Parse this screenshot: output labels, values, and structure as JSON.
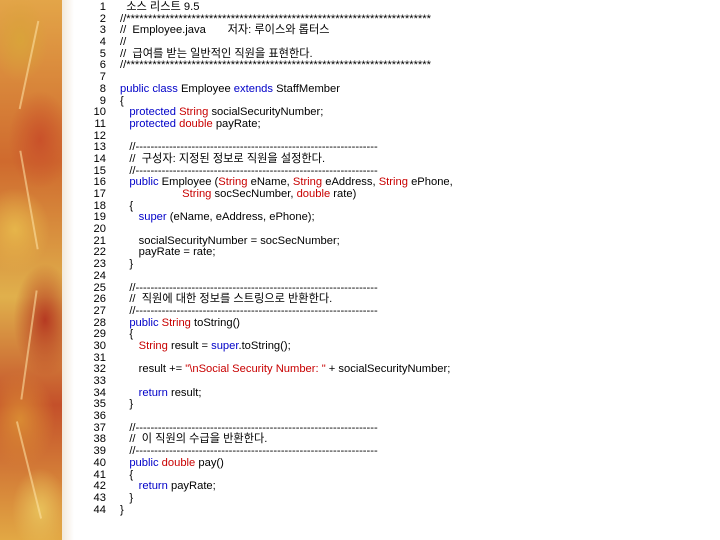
{
  "lines": [
    {
      "n": "1",
      "segs": [
        {
          "c": "cm",
          "t": "  소스 리스트 9.5"
        }
      ]
    },
    {
      "n": "2",
      "segs": [
        {
          "c": "cm",
          "t": "//**********************************************************************"
        }
      ]
    },
    {
      "n": "3",
      "segs": [
        {
          "c": "cm",
          "t": "//  Employee.java       저자: 루이스와 롭터스"
        }
      ]
    },
    {
      "n": "4",
      "segs": [
        {
          "c": "cm",
          "t": "//"
        }
      ]
    },
    {
      "n": "5",
      "segs": [
        {
          "c": "cm",
          "t": "//  급여를 받는 일반적인 직원을 표현한다."
        }
      ]
    },
    {
      "n": "6",
      "segs": [
        {
          "c": "cm",
          "t": "//**********************************************************************"
        }
      ]
    },
    {
      "n": "7",
      "segs": []
    },
    {
      "n": "8",
      "segs": [
        {
          "c": "kw",
          "t": "public class "
        },
        {
          "c": "",
          "t": "Employee "
        },
        {
          "c": "kw",
          "t": "extends "
        },
        {
          "c": "",
          "t": "StaffMember"
        }
      ]
    },
    {
      "n": "9",
      "segs": [
        {
          "c": "",
          "t": "{"
        }
      ]
    },
    {
      "n": "10",
      "segs": [
        {
          "c": "kw",
          "t": "   protected "
        },
        {
          "c": "ty",
          "t": "String "
        },
        {
          "c": "",
          "t": "socialSecurityNumber;"
        }
      ]
    },
    {
      "n": "11",
      "segs": [
        {
          "c": "kw",
          "t": "   protected "
        },
        {
          "c": "ty",
          "t": "double "
        },
        {
          "c": "",
          "t": "payRate;"
        }
      ]
    },
    {
      "n": "12",
      "segs": []
    },
    {
      "n": "13",
      "segs": [
        {
          "c": "cm",
          "t": "   //-----------------------------------------------------------------"
        }
      ]
    },
    {
      "n": "14",
      "segs": [
        {
          "c": "cm",
          "t": "   //  구성자: 지정된 정보로 직원을 설정한다."
        }
      ]
    },
    {
      "n": "15",
      "segs": [
        {
          "c": "cm",
          "t": "   //-----------------------------------------------------------------"
        }
      ]
    },
    {
      "n": "16",
      "segs": [
        {
          "c": "kw",
          "t": "   public "
        },
        {
          "c": "",
          "t": "Employee ("
        },
        {
          "c": "ty",
          "t": "String "
        },
        {
          "c": "",
          "t": "eName, "
        },
        {
          "c": "ty",
          "t": "String "
        },
        {
          "c": "",
          "t": "eAddress, "
        },
        {
          "c": "ty",
          "t": "String "
        },
        {
          "c": "",
          "t": "ePhone,"
        }
      ]
    },
    {
      "n": "17",
      "segs": [
        {
          "c": "ty",
          "t": "                    String "
        },
        {
          "c": "",
          "t": "socSecNumber, "
        },
        {
          "c": "ty",
          "t": "double "
        },
        {
          "c": "",
          "t": "rate)"
        }
      ]
    },
    {
      "n": "18",
      "segs": [
        {
          "c": "",
          "t": "   {"
        }
      ]
    },
    {
      "n": "19",
      "segs": [
        {
          "c": "kw",
          "t": "      super "
        },
        {
          "c": "",
          "t": "(eName, eAddress, ePhone);"
        }
      ]
    },
    {
      "n": "20",
      "segs": []
    },
    {
      "n": "21",
      "segs": [
        {
          "c": "",
          "t": "      socialSecurityNumber = socSecNumber;"
        }
      ]
    },
    {
      "n": "22",
      "segs": [
        {
          "c": "",
          "t": "      payRate = rate;"
        }
      ]
    },
    {
      "n": "23",
      "segs": [
        {
          "c": "",
          "t": "   }"
        }
      ]
    },
    {
      "n": "24",
      "segs": []
    },
    {
      "n": "25",
      "segs": [
        {
          "c": "cm",
          "t": "   //-----------------------------------------------------------------"
        }
      ]
    },
    {
      "n": "26",
      "segs": [
        {
          "c": "cm",
          "t": "   //  직원에 대한 정보를 스트링으로 반환한다."
        }
      ]
    },
    {
      "n": "27",
      "segs": [
        {
          "c": "cm",
          "t": "   //-----------------------------------------------------------------"
        }
      ]
    },
    {
      "n": "28",
      "segs": [
        {
          "c": "kw",
          "t": "   public "
        },
        {
          "c": "ty",
          "t": "String "
        },
        {
          "c": "",
          "t": "toString()"
        }
      ]
    },
    {
      "n": "29",
      "segs": [
        {
          "c": "",
          "t": "   {"
        }
      ]
    },
    {
      "n": "30",
      "segs": [
        {
          "c": "ty",
          "t": "      String "
        },
        {
          "c": "",
          "t": "result = "
        },
        {
          "c": "kw",
          "t": "super"
        },
        {
          "c": "",
          "t": ".toString();"
        }
      ]
    },
    {
      "n": "31",
      "segs": []
    },
    {
      "n": "32",
      "segs": [
        {
          "c": "",
          "t": "      result += "
        },
        {
          "c": "st",
          "t": "\"\\nSocial Security Number: \""
        },
        {
          "c": "",
          "t": " + socialSecurityNumber;"
        }
      ]
    },
    {
      "n": "33",
      "segs": []
    },
    {
      "n": "34",
      "segs": [
        {
          "c": "kw",
          "t": "      return "
        },
        {
          "c": "",
          "t": "result;"
        }
      ]
    },
    {
      "n": "35",
      "segs": [
        {
          "c": "",
          "t": "   }"
        }
      ]
    },
    {
      "n": "36",
      "segs": []
    },
    {
      "n": "37",
      "segs": [
        {
          "c": "cm",
          "t": "   //-----------------------------------------------------------------"
        }
      ]
    },
    {
      "n": "38",
      "segs": [
        {
          "c": "cm",
          "t": "   //  이 직원의 수급을 반환한다."
        }
      ]
    },
    {
      "n": "39",
      "segs": [
        {
          "c": "cm",
          "t": "   //-----------------------------------------------------------------"
        }
      ]
    },
    {
      "n": "40",
      "segs": [
        {
          "c": "kw",
          "t": "   public "
        },
        {
          "c": "ty",
          "t": "double "
        },
        {
          "c": "",
          "t": "pay()"
        }
      ]
    },
    {
      "n": "41",
      "segs": [
        {
          "c": "",
          "t": "   {"
        }
      ]
    },
    {
      "n": "42",
      "segs": [
        {
          "c": "kw",
          "t": "      return "
        },
        {
          "c": "",
          "t": "payRate;"
        }
      ]
    },
    {
      "n": "43",
      "segs": [
        {
          "c": "",
          "t": "   }"
        }
      ]
    },
    {
      "n": "44",
      "segs": [
        {
          "c": "",
          "t": "}"
        }
      ]
    }
  ],
  "colors": {
    "keyword": "#0000c8",
    "type": "#c80000",
    "text": "#000000"
  }
}
